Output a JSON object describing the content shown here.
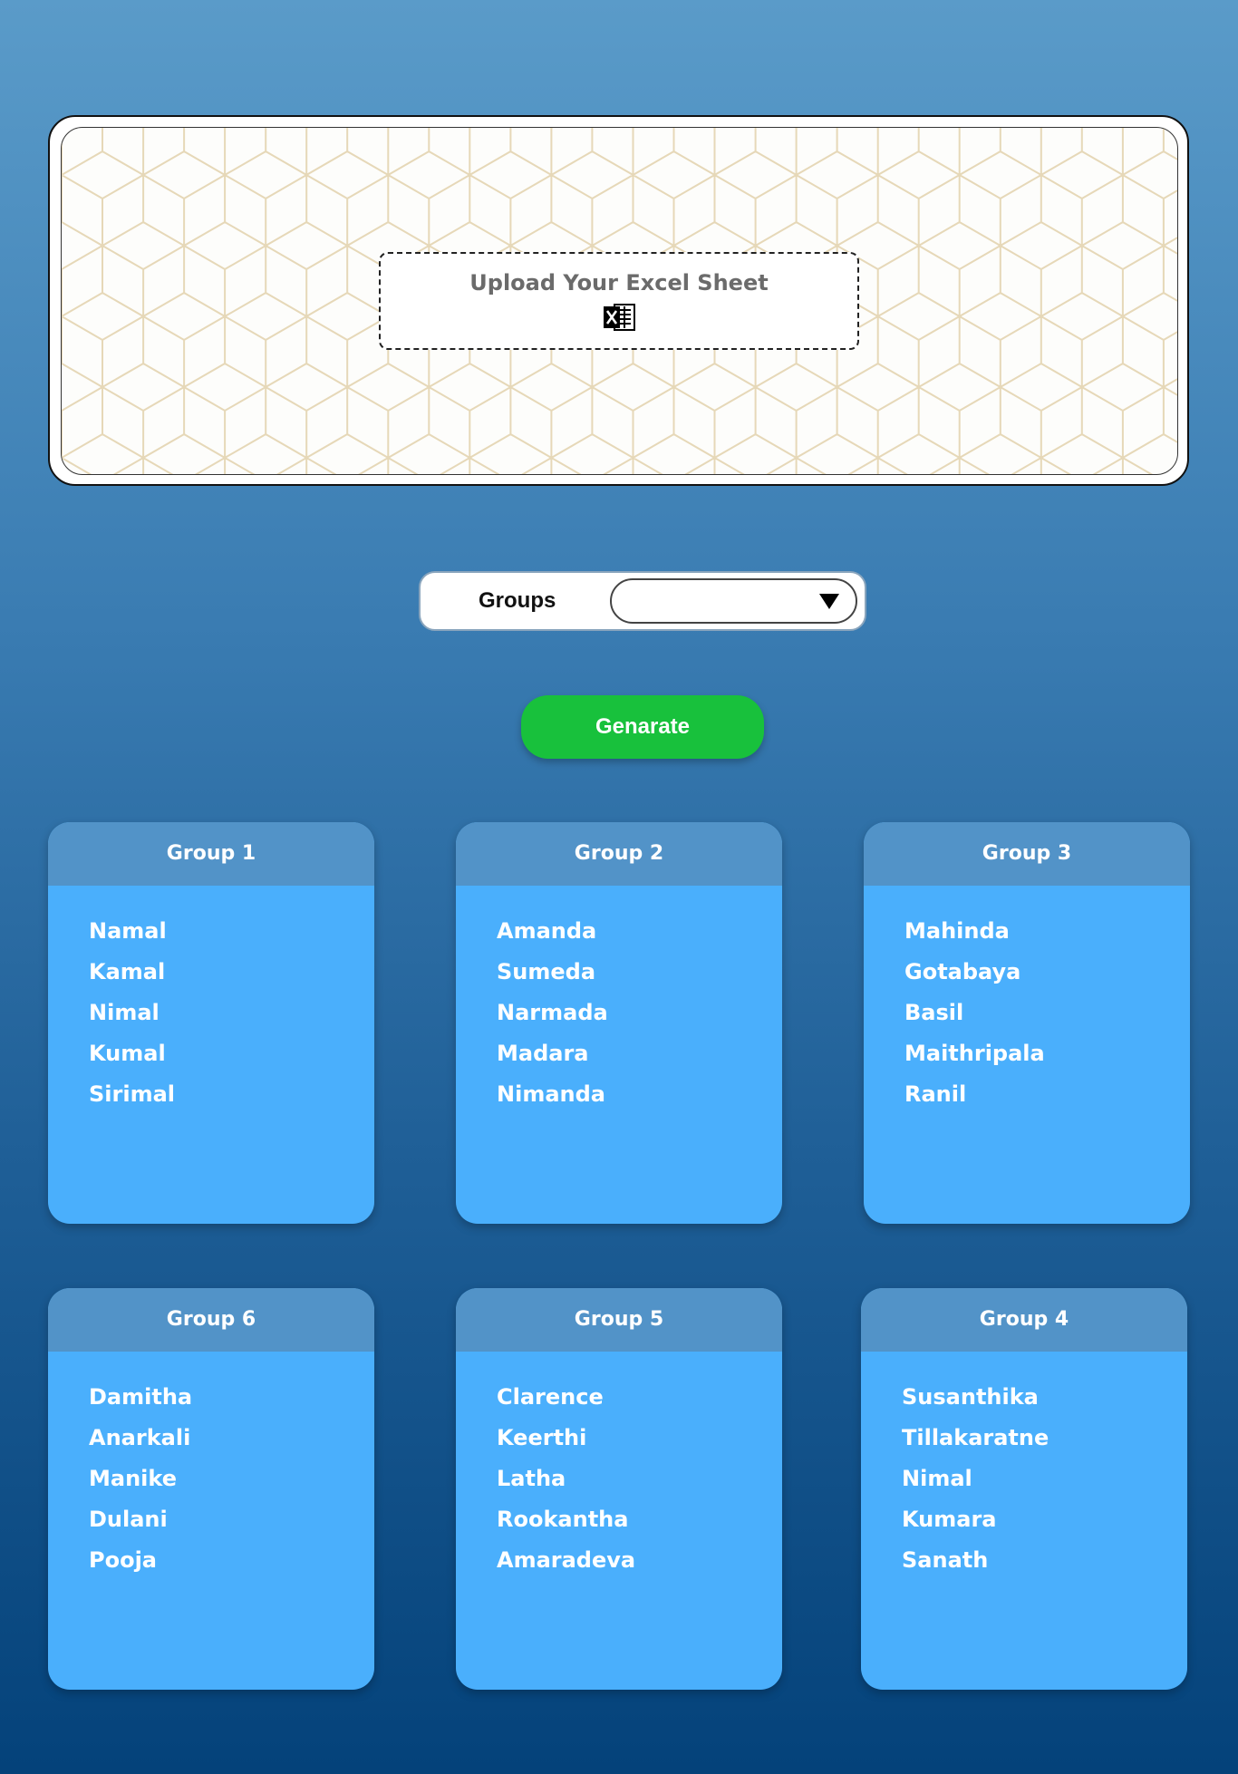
{
  "upload": {
    "title": "Upload Your Excel Sheet",
    "icon": "excel-icon"
  },
  "groups_select": {
    "label": "Groups",
    "value": ""
  },
  "generate_button": {
    "label": "Genarate"
  },
  "colors": {
    "generate_button": "#18c13c",
    "card_body": "#4aaffc",
    "card_header": "#5293c8",
    "pattern_lines": "#e6d8b8"
  },
  "groups": [
    {
      "title": "Group 1",
      "members": [
        "Namal",
        "Kamal",
        "Nimal",
        "Kumal",
        "Sirimal"
      ]
    },
    {
      "title": "Group 2",
      "members": [
        "Amanda",
        "Sumeda",
        "Narmada",
        "Madara",
        "Nimanda"
      ]
    },
    {
      "title": "Group 3",
      "members": [
        "Mahinda",
        "Gotabaya",
        "Basil",
        "Maithripala",
        "Ranil"
      ]
    },
    {
      "title": "Group 6",
      "members": [
        "Damitha",
        "Anarkali",
        "Manike",
        "Dulani",
        "Pooja"
      ]
    },
    {
      "title": "Group 5",
      "members": [
        "Clarence",
        "Keerthi",
        "Latha",
        "Rookantha",
        "Amaradeva"
      ]
    },
    {
      "title": "Group 4",
      "members": [
        "Susanthika",
        "Tillakaratne",
        "Nimal",
        "Kumara",
        "Sanath"
      ]
    }
  ]
}
